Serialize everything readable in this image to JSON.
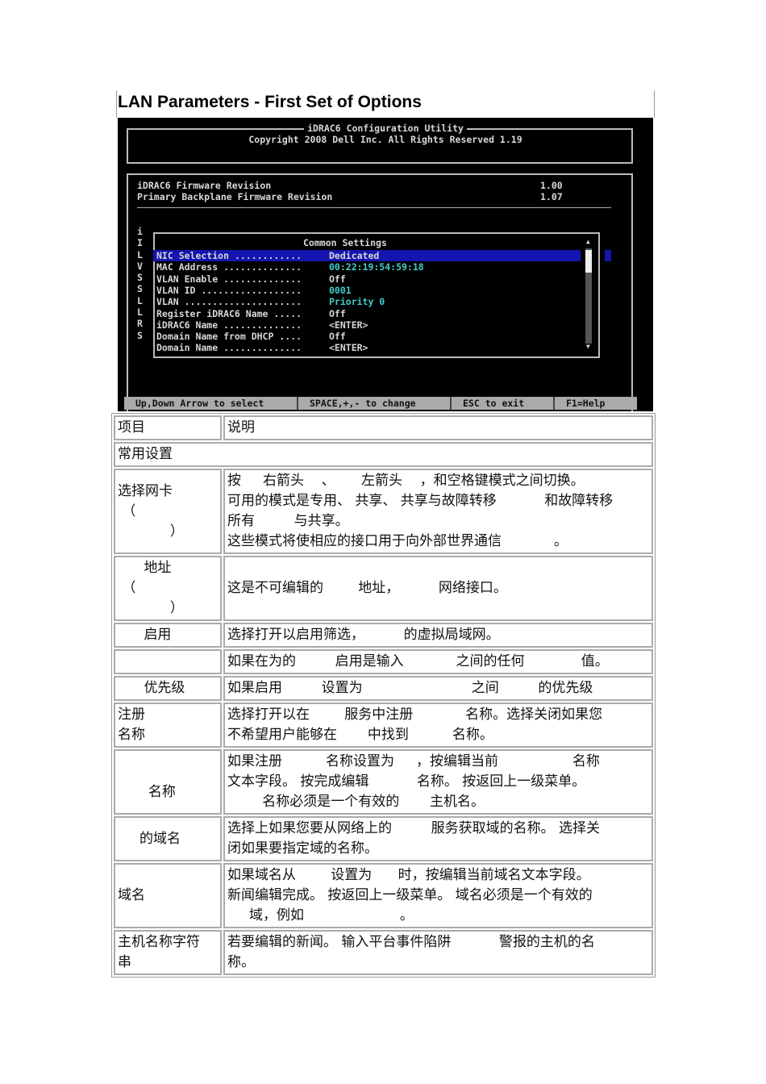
{
  "title": "LAN Parameters - First Set of Options",
  "screen": {
    "header1": "iDRAC6 Configuration Utility",
    "header2": "Copyright 2008 Dell Inc. All Rights Reserved 1.19",
    "fw": [
      {
        "label": "iDRAC6 Firmware Revision",
        "value": "1.00"
      },
      {
        "label": "Primary Backplane Firmware Revision",
        "value": "1.07"
      }
    ],
    "side_letters": "i\nI\nL\nV\nS\nS\nL\nL\nR\nS",
    "popup_title": "Common Settings",
    "settings": [
      {
        "label": "NIC Selection ............",
        "value": "Dedicated"
      },
      {
        "label": "MAC Address ..............",
        "value": "00:22:19:54:59:18"
      },
      {
        "label": "VLAN Enable ..............",
        "value": "Off"
      },
      {
        "label": "VLAN ID ..................",
        "value": "0001"
      },
      {
        "label": "VLAN .....................",
        "value": "Priority 0"
      },
      {
        "label": "Register iDRAC6 Name .....",
        "value": "Off"
      },
      {
        "label": "iDRAC6 Name ..............",
        "value": "<ENTER>"
      },
      {
        "label": "Domain Name from DHCP ....",
        "value": "Off"
      },
      {
        "label": "Domain Name ..............",
        "value": "<ENTER>"
      }
    ],
    "status": [
      "Up,Down Arrow to select",
      "SPACE,+,- to change",
      "ESC to exit",
      "F1=Help"
    ]
  },
  "table": {
    "header": [
      "项目",
      "说明"
    ],
    "section": "常用设置",
    "rows": [
      {
        "k": "选择网卡\n （\n            ）",
        "v": "按     右箭头    、      左箭头    ，和空格键模式之间切换。\n可用的模式是专用、 共享、 共享与故障转移           和故障转移\n所有         与共享。\n这些模式将使相应的接口用于向外部世界通信            。"
      },
      {
        "k": "      地址\n （\n            ）",
        "v": "这是不可编辑的        地址，         网络接口。"
      },
      {
        "k": "      启用",
        "v": "选择打开以启用筛选，         的虚拟局域网。"
      },
      {
        "k": "",
        "v": "如果在为的         启用是输入            之间的任何             值。"
      },
      {
        "k": "      优先级",
        "v": "如果启用         设置为                         之间         的优先级"
      },
      {
        "k": "注册\n名称",
        "v": "选择打开以在        服务中注册            名称。选择关闭如果您\n不希望用户能够在       中找到          名称。"
      },
      {
        "k": "\n       名称",
        "v": "如果注册          名称设置为     ，按编辑当前                 名称\n文本字段。 按完成编辑           名称。 按返回上一级菜单。\n        名称必须是一个有效的       主机名。"
      },
      {
        "k": "     的域名",
        "v": "选择上如果您要从网络上的         服务获取域的名称。 选择关\n闭如果要指定域的名称。"
      },
      {
        "k": "域名",
        "v": "如果域名从        设置为      时，按编辑当前域名文本字段。\n新闻编辑完成。 按返回上一级菜单。 域名必须是一个有效的\n     域，例如                      。"
      },
      {
        "k": "主机名称字符\n串",
        "v": "若要编辑的新闻。 输入平台事件陷阱           警报的主机的名\n称。"
      }
    ]
  }
}
